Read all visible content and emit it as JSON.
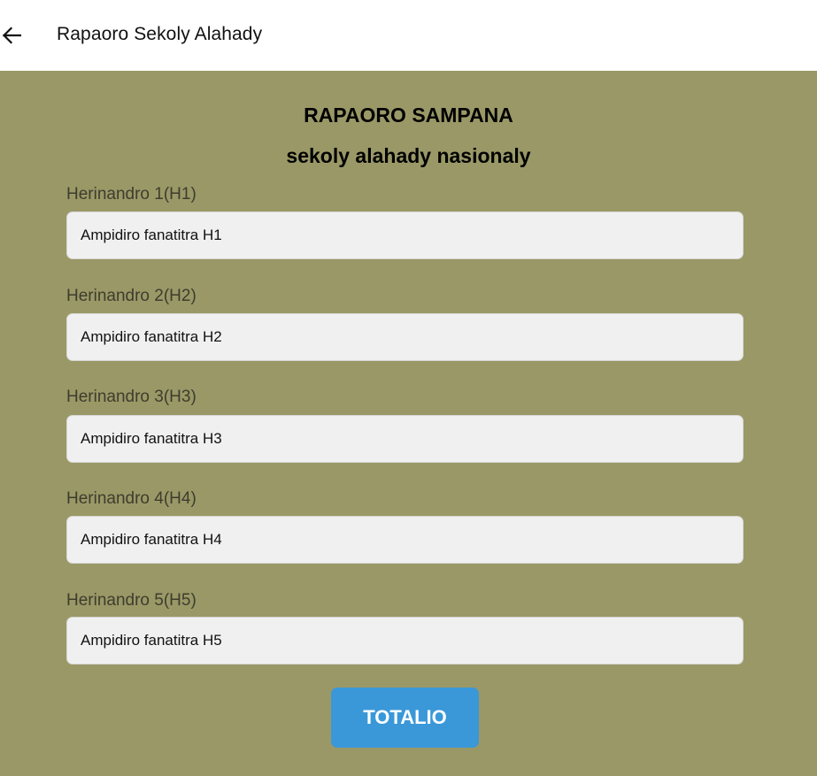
{
  "appbar": {
    "back_icon": "arrow-left-icon",
    "title": "Rapaoro Sekoly Alahady"
  },
  "form": {
    "heading": "RAPAORO SAMPANA",
    "subheading": "sekoly alahady nasionaly",
    "fields": [
      {
        "label": "Herinandro 1(H1)",
        "value": "",
        "placeholder": "Ampidiro fanatitra H1"
      },
      {
        "label": "Herinandro 2(H2)",
        "value": "",
        "placeholder": "Ampidiro fanatitra H2"
      },
      {
        "label": "Herinandro 3(H3)",
        "value": "",
        "placeholder": "Ampidiro fanatitra H3"
      },
      {
        "label": "Herinandro 4(H4)",
        "value": "",
        "placeholder": "Ampidiro fanatitra H4"
      },
      {
        "label": "Herinandro 5(H5)",
        "value": "",
        "placeholder": "Ampidiro fanatitra H5"
      }
    ],
    "submit_label": "TOTALIO"
  },
  "colors": {
    "background": "#9a9866",
    "input_background": "#f0f0f0",
    "button": "#3a98d9",
    "button_text": "#ffffff"
  }
}
